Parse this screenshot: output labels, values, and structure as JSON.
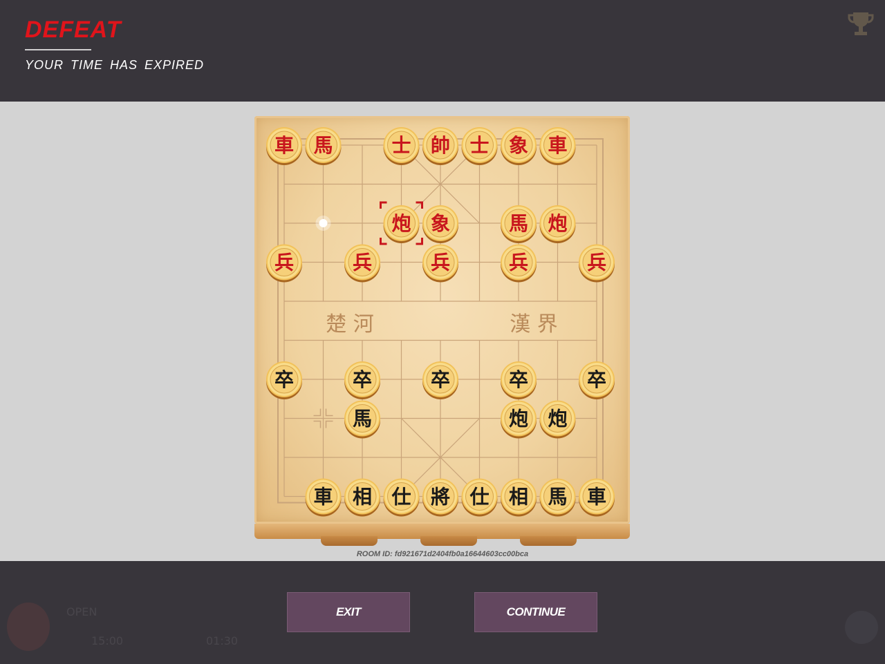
{
  "header": {
    "result": "DEFEAT",
    "reason": "YOUR TIME HAS EXPIRED"
  },
  "board": {
    "river_left": "楚 河",
    "river_right": "漢 界",
    "red_pieces": [
      {
        "label": "車",
        "col": 0,
        "row": 0
      },
      {
        "label": "馬",
        "col": 1,
        "row": 0
      },
      {
        "label": "士",
        "col": 3,
        "row": 0
      },
      {
        "label": "帥",
        "col": 4,
        "row": 0
      },
      {
        "label": "士",
        "col": 5,
        "row": 0
      },
      {
        "label": "象",
        "col": 6,
        "row": 0
      },
      {
        "label": "車",
        "col": 7,
        "row": 0
      },
      {
        "label": "炮",
        "col": 3,
        "row": 2,
        "selected": true
      },
      {
        "label": "象",
        "col": 4,
        "row": 2
      },
      {
        "label": "馬",
        "col": 6,
        "row": 2
      },
      {
        "label": "炮",
        "col": 7,
        "row": 2
      },
      {
        "label": "兵",
        "col": 0,
        "row": 3
      },
      {
        "label": "兵",
        "col": 2,
        "row": 3
      },
      {
        "label": "兵",
        "col": 4,
        "row": 3
      },
      {
        "label": "兵",
        "col": 6,
        "row": 3
      },
      {
        "label": "兵",
        "col": 8,
        "row": 3
      }
    ],
    "black_pieces": [
      {
        "label": "卒",
        "col": 0,
        "row": 6
      },
      {
        "label": "卒",
        "col": 2,
        "row": 6
      },
      {
        "label": "卒",
        "col": 4,
        "row": 6
      },
      {
        "label": "卒",
        "col": 6,
        "row": 6
      },
      {
        "label": "卒",
        "col": 8,
        "row": 6
      },
      {
        "label": "馬",
        "col": 2,
        "row": 7
      },
      {
        "label": "炮",
        "col": 6,
        "row": 7
      },
      {
        "label": "炮",
        "col": 7,
        "row": 7
      },
      {
        "label": "車",
        "col": 1,
        "row": 9
      },
      {
        "label": "相",
        "col": 2,
        "row": 9
      },
      {
        "label": "仕",
        "col": 3,
        "row": 9
      },
      {
        "label": "將",
        "col": 4,
        "row": 9
      },
      {
        "label": "仕",
        "col": 5,
        "row": 9
      },
      {
        "label": "相",
        "col": 6,
        "row": 9
      },
      {
        "label": "馬",
        "col": 7,
        "row": 9
      },
      {
        "label": "車",
        "col": 8,
        "row": 9
      }
    ],
    "last_move_origin": {
      "col": 1,
      "row": 2
    },
    "cross_marker": {
      "col": 1,
      "row": 7
    }
  },
  "room": {
    "label": "ROOM ID: fd921671d2404fb0a16644603cc00bca"
  },
  "footer": {
    "exit_label": "EXIT",
    "continue_label": "CONTINUE",
    "player_status": "OPEN",
    "total_time": "15:00",
    "move_time": "01:30"
  },
  "colors": {
    "red_piece_text": "#c8161d",
    "black_piece_text": "#1a1a1a",
    "defeat": "#e0141b",
    "button": "#63475f"
  },
  "icons": {
    "trophy": "trophy-icon",
    "avatar": "player-avatar",
    "corner": "chevron-up-icon"
  }
}
